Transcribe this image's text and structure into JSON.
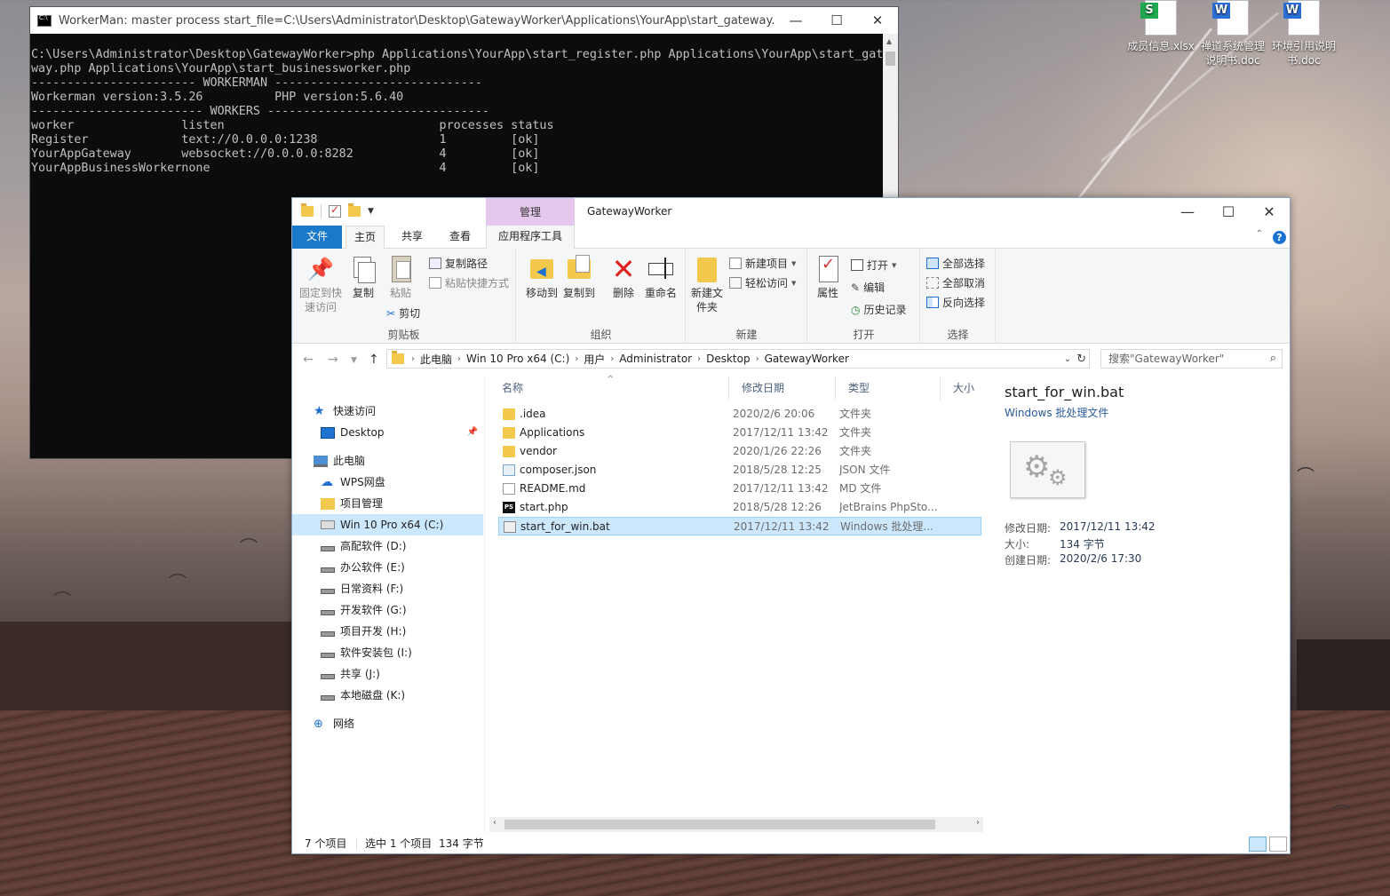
{
  "desktop": {
    "icons": [
      {
        "label": "成员信息.xlsx",
        "badge": "S",
        "color": "#1fa84f"
      },
      {
        "label": "禅道系统管理说明书.doc",
        "badge": "W",
        "color": "#2a6fd6"
      },
      {
        "label": "环境引用说明书.doc",
        "badge": "W",
        "color": "#2a6fd6"
      }
    ]
  },
  "console": {
    "title": "WorkerMan: master process  start_file=C:\\Users\\Administrator\\Desktop\\GatewayWorker\\Applications\\YourApp\\start_gateway.php",
    "output": "C:\\Users\\Administrator\\Desktop\\GatewayWorker>php Applications\\YourApp\\start_register.php Applications\\YourApp\\start_gate\nway.php Applications\\YourApp\\start_businessworker.php\n----------------------- WORKERMAN -----------------------------\nWorkerman version:3.5.26          PHP version:5.6.40\n------------------------ WORKERS -------------------------------\nworker               listen                              processes status\nRegister             text://0.0.0.0:1238                 1         [ok]\nYourAppGateway       websocket://0.0.0.0:8282            4         [ok]\nYourAppBusinessWorkernone                                4         [ok]"
  },
  "explorer": {
    "caption": "GatewayWorker",
    "manage_tab": "管理",
    "tabs": {
      "file": "文件",
      "home": "主页",
      "share": "共享",
      "view": "查看",
      "apptools": "应用程序工具"
    },
    "ribbon": {
      "clipboard": {
        "label": "剪贴板",
        "pin": "固定到快速访问",
        "copy": "复制",
        "paste": "粘贴",
        "copy_path": "复制路径",
        "paste_shortcut": "粘贴快捷方式",
        "cut": "剪切"
      },
      "organize": {
        "label": "组织",
        "move_to": "移动到",
        "copy_to": "复制到",
        "delete": "删除",
        "rename": "重命名"
      },
      "new": {
        "label": "新建",
        "new_folder": "新建文件夹",
        "new_item": "新建项目",
        "easy_access": "轻松访问"
      },
      "open": {
        "label": "打开",
        "properties": "属性",
        "open": "打开",
        "edit": "编辑",
        "history": "历史记录"
      },
      "select": {
        "label": "选择",
        "select_all": "全部选择",
        "select_none": "全部取消",
        "invert": "反向选择"
      }
    },
    "address": [
      "此电脑",
      "Win 10 Pro x64 (C:)",
      "用户",
      "Administrator",
      "Desktop",
      "GatewayWorker"
    ],
    "search_placeholder": "搜索\"GatewayWorker\"",
    "nav": [
      {
        "label": "快速访问",
        "icon": "star-icon",
        "kind": "star",
        "indent": 0
      },
      {
        "label": "Desktop",
        "icon": "desktop-icon",
        "kind": "desk",
        "indent": 1,
        "pinned": true
      },
      {
        "label": "此电脑",
        "icon": "computer-icon",
        "kind": "pc",
        "indent": 0
      },
      {
        "label": "WPS网盘",
        "icon": "cloud-icon",
        "kind": "cloud",
        "indent": 1
      },
      {
        "label": "项目管理",
        "icon": "folder-icon",
        "kind": "folder",
        "indent": 1
      },
      {
        "label": "Win 10 Pro x64 (C:)",
        "icon": "drive-icon",
        "kind": "drivec",
        "indent": 1,
        "selected": true
      },
      {
        "label": "高配软件 (D:)",
        "icon": "drive-icon",
        "kind": "drive",
        "indent": 1
      },
      {
        "label": "办公软件 (E:)",
        "icon": "drive-icon",
        "kind": "drive",
        "indent": 1
      },
      {
        "label": "日常资料 (F:)",
        "icon": "drive-icon",
        "kind": "drive",
        "indent": 1
      },
      {
        "label": "开发软件 (G:)",
        "icon": "drive-icon",
        "kind": "drive",
        "indent": 1
      },
      {
        "label": "项目开发 (H:)",
        "icon": "drive-icon",
        "kind": "drive",
        "indent": 1
      },
      {
        "label": "软件安装包 (I:)",
        "icon": "drive-icon",
        "kind": "drive",
        "indent": 1
      },
      {
        "label": "共享 (J:)",
        "icon": "drive-icon",
        "kind": "drive",
        "indent": 1
      },
      {
        "label": "本地磁盘 (K:)",
        "icon": "drive-icon",
        "kind": "drive",
        "indent": 1
      },
      {
        "label": "网络",
        "icon": "network-icon",
        "kind": "net",
        "indent": 0
      }
    ],
    "columns": {
      "name": "名称",
      "date": "修改日期",
      "type": "类型",
      "size": "大小"
    },
    "files": [
      {
        "name": ".idea",
        "date": "2020/2/6 20:06",
        "type": "文件夹",
        "kind": "folder"
      },
      {
        "name": "Applications",
        "date": "2017/12/11 13:42",
        "type": "文件夹",
        "kind": "folder"
      },
      {
        "name": "vendor",
        "date": "2020/1/26 22:26",
        "type": "文件夹",
        "kind": "folder"
      },
      {
        "name": "composer.json",
        "date": "2018/5/28 12:25",
        "type": "JSON 文件",
        "kind": "json"
      },
      {
        "name": "README.md",
        "date": "2017/12/11 13:42",
        "type": "MD 文件",
        "kind": "md"
      },
      {
        "name": "start.php",
        "date": "2018/5/28 12:26",
        "type": "JetBrains PhpSto...",
        "kind": "php"
      },
      {
        "name": "start_for_win.bat",
        "date": "2017/12/11 13:42",
        "type": "Windows 批处理...",
        "kind": "bat",
        "selected": true
      }
    ],
    "details": {
      "name": "start_for_win.bat",
      "type": "Windows 批处理文件",
      "modified_label": "修改日期:",
      "modified": "2017/12/11 13:42",
      "size_label": "大小:",
      "size": "134 字节",
      "created_label": "创建日期:",
      "created": "2020/2/6 17:30"
    },
    "status": {
      "count": "7 个项目",
      "selected": "选中 1 个项目",
      "size": "134 字节"
    }
  }
}
